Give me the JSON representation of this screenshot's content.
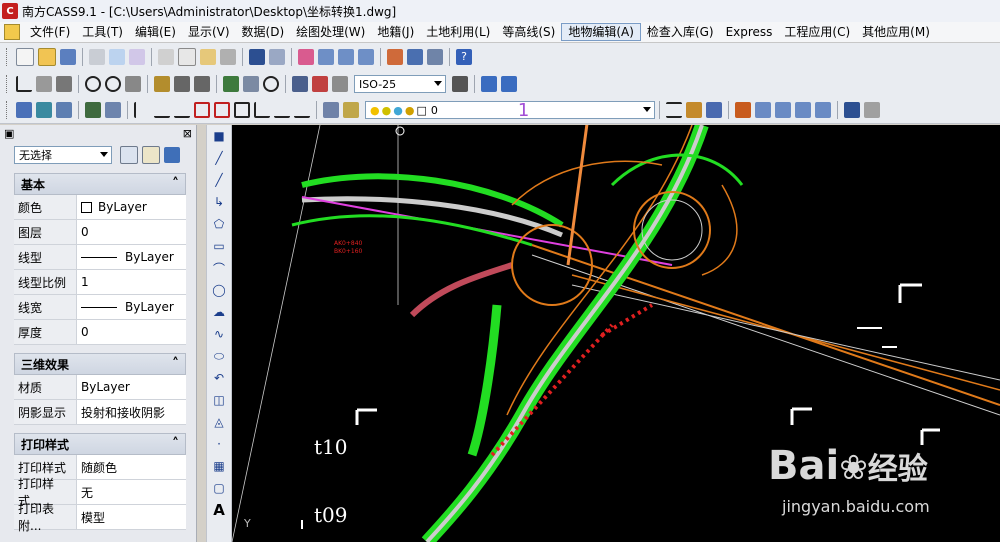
{
  "window": {
    "title": "南方CASS9.1 - [C:\\Users\\Administrator\\Desktop\\坐标转换1.dwg]",
    "app_icon_text": "C"
  },
  "menu": [
    "文件(F)",
    "工具(T)",
    "编辑(E)",
    "显示(V)",
    "数据(D)",
    "绘图处理(W)",
    "地籍(J)",
    "土地利用(L)",
    "等高线(S)",
    "地物编辑(A)",
    "检查入库(G)",
    "Express",
    "工程应用(C)",
    "其他应用(M)"
  ],
  "menu_active": "地物编辑(A)",
  "toolbar2": {
    "style_combo": "ISO-25"
  },
  "toolbar3": {
    "layer_value": "0",
    "layer_number": "1"
  },
  "properties": {
    "selection": "无选择",
    "sections": [
      {
        "title": "基本",
        "rows": [
          {
            "label": "颜色",
            "value": "ByLayer",
            "kind": "color"
          },
          {
            "label": "图层",
            "value": "0"
          },
          {
            "label": "线型",
            "value": "ByLayer",
            "kind": "line"
          },
          {
            "label": "线型比例",
            "value": "1"
          },
          {
            "label": "线宽",
            "value": "ByLayer",
            "kind": "line"
          },
          {
            "label": "厚度",
            "value": "0"
          }
        ]
      },
      {
        "title": "三维效果",
        "rows": [
          {
            "label": "材质",
            "value": "ByLayer"
          },
          {
            "label": "阴影显示",
            "value": "投射和接收阴影"
          }
        ]
      },
      {
        "title": "打印样式",
        "rows": [
          {
            "label": "打印样式",
            "value": "随颜色"
          },
          {
            "label": "打印样式...",
            "value": "无"
          },
          {
            "label": "打印表附...",
            "value": "模型"
          }
        ]
      }
    ]
  },
  "canvas": {
    "labels": [
      "t10",
      "t09"
    ],
    "road_labels": [
      "AK0+840",
      "BK0+160"
    ],
    "ucs_label": "Y"
  },
  "watermark": {
    "brand": "Bai",
    "brand2": "经验",
    "url": "jingyan.baidu.com"
  },
  "colors": {
    "accent_arrow": "#f08a3c",
    "canvas_bg": "#000000",
    "road_green": "#22dd22",
    "road_orange": "#e07a1a",
    "road_magenta": "#e040e0",
    "marker_red": "#e02020"
  }
}
